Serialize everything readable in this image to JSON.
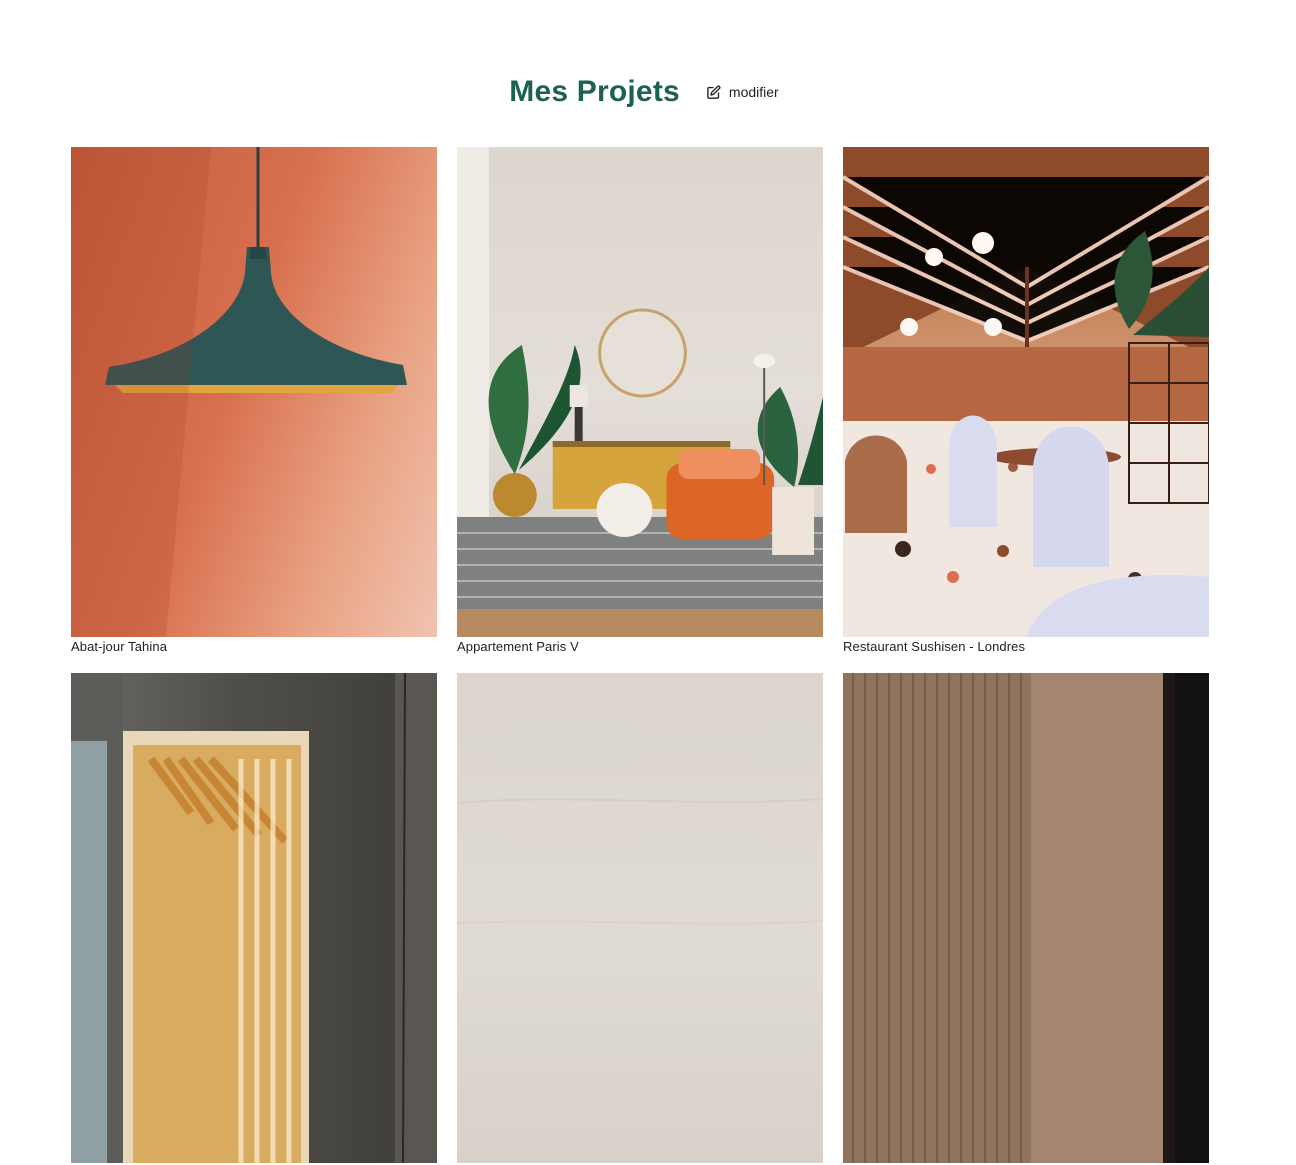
{
  "header": {
    "title": "Mes Projets",
    "edit_label": "modifier"
  },
  "gallery": {
    "items": [
      {
        "caption": "Abat-jour Tahina"
      },
      {
        "caption": "Appartement Paris V"
      },
      {
        "caption": "Restaurant Sushisen - Londres"
      },
      {
        "caption": ""
      },
      {
        "caption": ""
      },
      {
        "caption": ""
      }
    ]
  },
  "icons": {
    "edit": "edit-icon"
  },
  "colors": {
    "title": "#1d6154"
  }
}
